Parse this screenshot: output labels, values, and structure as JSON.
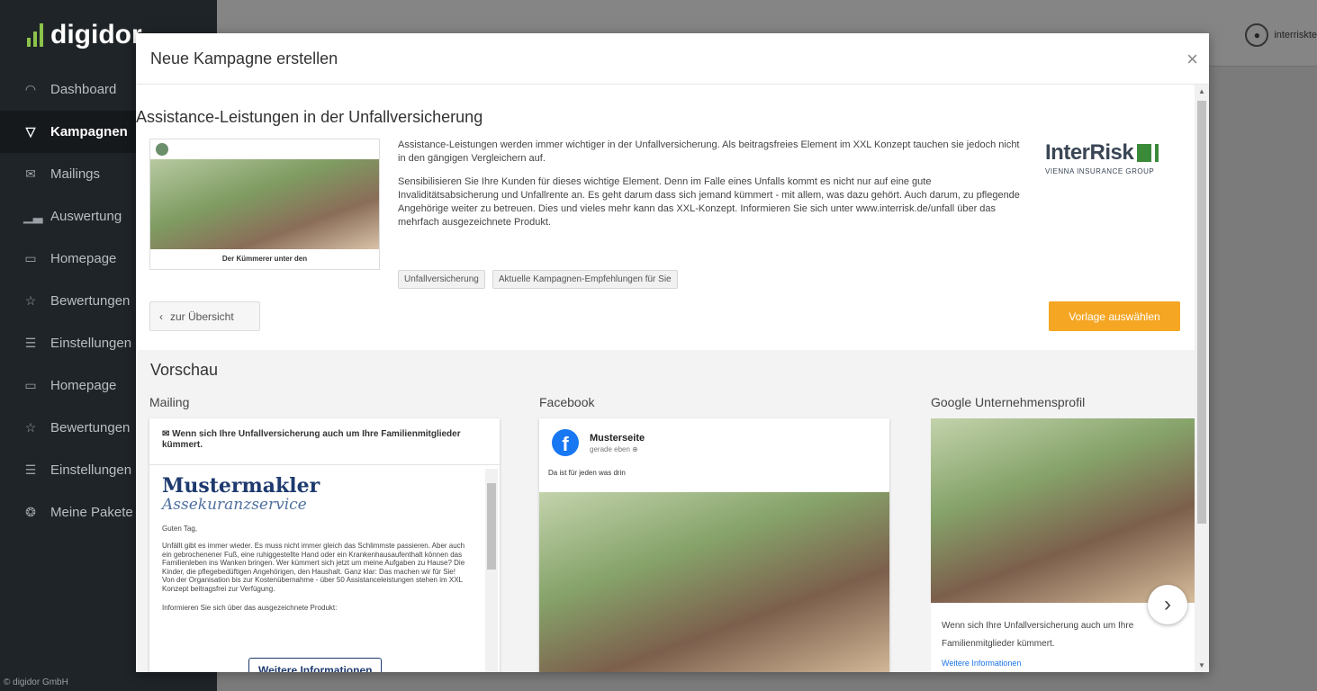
{
  "app": {
    "logo_text": "digidor",
    "copyright": "© digidor GmbH"
  },
  "sidebar": {
    "items": [
      {
        "label": "Dashboard",
        "icon": "gauge-icon"
      },
      {
        "label": "Kampagnen",
        "icon": "filter-icon",
        "active": true
      },
      {
        "label": "Mailings",
        "icon": "mail-icon"
      },
      {
        "label": "Auswertung",
        "icon": "chart-icon"
      },
      {
        "label": "Homepage",
        "icon": "monitor-icon"
      },
      {
        "label": "Bewertungen",
        "icon": "star-icon"
      },
      {
        "label": "Einstellungen",
        "icon": "sliders-icon"
      },
      {
        "label": "Homepage",
        "icon": "monitor-icon"
      },
      {
        "label": "Bewertungen",
        "icon": "star-icon"
      },
      {
        "label": "Einstellungen",
        "icon": "sliders-icon"
      },
      {
        "label": "Meine Pakete",
        "icon": "package-icon"
      }
    ]
  },
  "header": {
    "user_name": "interriskte"
  },
  "modal": {
    "title": "Neue Kampagne erstellen",
    "close_label": "×",
    "campaign": {
      "title": "Assistance-Leistungen in der Unfallversicherung",
      "thumbnail_caption": "Der Kümmerer unter den",
      "description_1": "Assistance-Leistungen werden immer wichtiger in der Unfallversicherung. Als beitragsfreies Element im XXL Konzept tauchen sie jedoch nicht in den gängigen Vergleichern auf.",
      "description_2": "Sensibilisieren Sie Ihre Kunden für dieses wichtige Element. Denn im Falle eines Unfalls kommt es nicht nur auf eine gute Invaliditätsabsicherung und Unfallrente an. Es geht darum dass sich jemand kümmert - mit allem, was dazu gehört. Auch darum, zu pflegende Angehörige weiter zu betreuen. Dies und vieles mehr kann das XXL-Konzept.  Informieren Sie sich unter www.interrisk.de/unfall über das mehrfach ausgezeichnete Produkt.",
      "tags": [
        "Unfallversicherung",
        "Aktuelle Kampagnen-Empfehlungen für Sie"
      ],
      "brand_name": "InterRisk",
      "brand_sub": "VIENNA INSURANCE GROUP"
    },
    "back_label": "zur Übersicht",
    "select_label": "Vorlage auswählen",
    "preview": {
      "title": "Vorschau",
      "mailing_label": "Mailing",
      "facebook_label": "Facebook",
      "google_label": "Google Unternehmensprofil",
      "mailing": {
        "subject": "Wenn sich Ihre Unfallversicherung auch um Ihre Familienmitglieder kümmert.",
        "company_name": "Mustermakler",
        "company_sub": "Assekuranzservice",
        "greeting": "Guten Tag,",
        "body": "Unfällt gibt es immer wieder. Es muss nicht immer gleich das Schlimmste passieren. Aber auch ein gebrochenener Fuß, eine ruhiggestellte Hand oder ein Krankenhausaufenthalt können das Familienleben ins Wanken bringen. Wer kümmert sich jetzt um meine Aufgaben zu Hause? Die Kinder, die pflegebedüftigen Angehörigen, den Haushalt. Ganz klar: Das machen wir für Sie! Von der Organisation bis zur Kostenübernahme - über 50 Assistanceleistungen stehen im XXL Konzept beitragsfrei zur Verfügung.",
        "inform": "Informieren Sie sich über das ausgezeichnete Produkt:",
        "button": "Weitere Informationen"
      },
      "facebook": {
        "page_name": "Musterseite",
        "time": "gerade eben",
        "text": "Da ist für jeden was drin"
      },
      "google": {
        "text": "Wenn sich Ihre Unfallversicherung auch um Ihre Familienmitglieder kümmert.",
        "link": "Weitere Informationen"
      }
    }
  }
}
